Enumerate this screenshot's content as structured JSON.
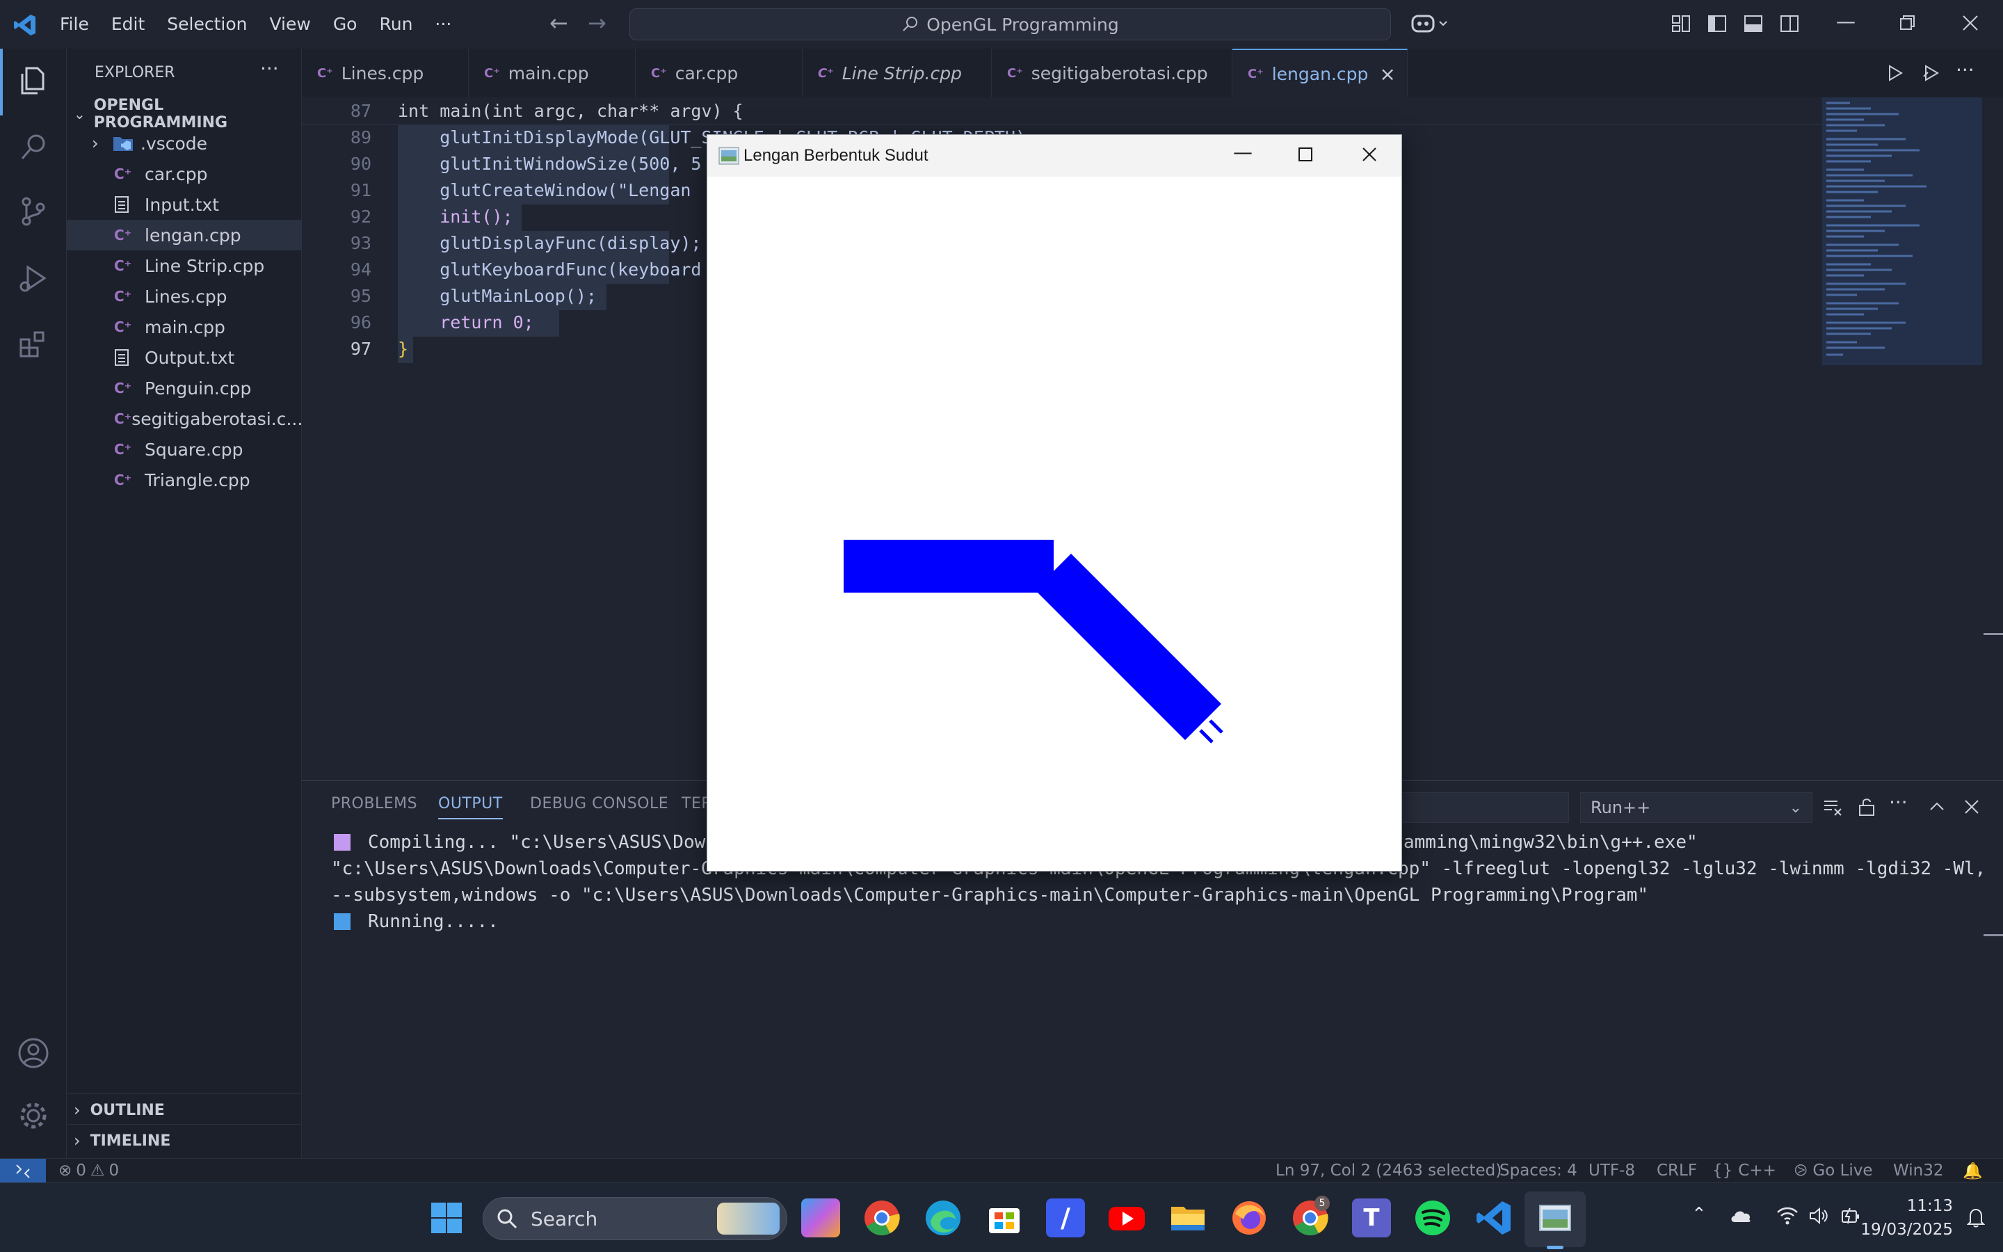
{
  "titlebar": {
    "menus": [
      "File",
      "Edit",
      "Selection",
      "View",
      "Go",
      "Run",
      "···"
    ],
    "command_center": "OpenGL Programming"
  },
  "sidebar": {
    "header": "EXPLORER",
    "project": "OPENGL PROGRAMMING",
    "items": [
      {
        "label": ".vscode",
        "type": "folder"
      },
      {
        "label": "car.cpp",
        "type": "cpp"
      },
      {
        "label": "Input.txt",
        "type": "txt"
      },
      {
        "label": "lengan.cpp",
        "type": "cpp",
        "selected": true
      },
      {
        "label": "Line Strip.cpp",
        "type": "cpp"
      },
      {
        "label": "Lines.cpp",
        "type": "cpp"
      },
      {
        "label": "main.cpp",
        "type": "cpp"
      },
      {
        "label": "Output.txt",
        "type": "txt"
      },
      {
        "label": "Penguin.cpp",
        "type": "cpp"
      },
      {
        "label": "segitigaberotasi.c...",
        "type": "cpp"
      },
      {
        "label": "Square.cpp",
        "type": "cpp"
      },
      {
        "label": "Triangle.cpp",
        "type": "cpp"
      }
    ],
    "outline": "OUTLINE",
    "timeline": "TIMELINE"
  },
  "tabs": [
    {
      "label": "Lines.cpp"
    },
    {
      "label": "main.cpp"
    },
    {
      "label": "car.cpp"
    },
    {
      "label": "Line Strip.cpp",
      "italic": true
    },
    {
      "label": "segitigaberotasi.cpp"
    },
    {
      "label": "lengan.cpp",
      "active": true
    }
  ],
  "editor": {
    "lines": [
      {
        "num": "87",
        "code": "int main(int argc, char** argv) {"
      },
      {
        "num": "89",
        "code": "    glutInitDisplayMode(GLUT_SINGLE | GLUT_RGB | GLUT_DEPTH);"
      },
      {
        "num": "90",
        "code": "    glutInitWindowSize(500, 5"
      },
      {
        "num": "91",
        "code": "    glutCreateWindow(\"Lengan"
      },
      {
        "num": "92",
        "code": "    init();"
      },
      {
        "num": "93",
        "code": "    glutDisplayFunc(display);"
      },
      {
        "num": "94",
        "code": "    glutKeyboardFunc(keyboard"
      },
      {
        "num": "95",
        "code": "    glutMainLoop();"
      },
      {
        "num": "96",
        "code": "    return 0;"
      },
      {
        "num": "97",
        "code": "}"
      }
    ]
  },
  "panel": {
    "tabs": [
      "PROBLEMS",
      "OUTPUT",
      "DEBUG CONSOLE",
      "TER"
    ],
    "dropdown": "Run++",
    "output": [
      "Compiling... \"c:\\Users\\ASUS\\Down",
      "amming\\mingw32\\bin\\g++.exe\"",
      "\"c:\\Users\\ASUS\\Downloads\\Computer-Graphics-main\\Computer-Graphics-main\\OpenGL Programming\\lengan.cpp\" -lfreeglut -lopengl32 -lglu32 -lwinmm -lgdi32 -Wl,",
      "--subsystem,windows -o \"c:\\Users\\ASUS\\Downloads\\Computer-Graphics-main\\Computer-Graphics-main\\OpenGL Programming\\Program\"",
      "Running....."
    ]
  },
  "statusbar": {
    "problems": "0",
    "warnings": "0",
    "cursor": "Ln 97, Col 2 (2463 selected)",
    "spaces": "Spaces: 4",
    "encoding": "UTF-8",
    "eol": "CRLF",
    "language": "C++",
    "golive": "Go Live",
    "platform": "Win32"
  },
  "glut_window": {
    "title": "Lengan Berbentuk Sudut",
    "fill_color": "#0000ff"
  },
  "taskbar": {
    "search": "Search",
    "time": "11:13",
    "date": "19/03/2025",
    "chrome_badge": "5"
  }
}
